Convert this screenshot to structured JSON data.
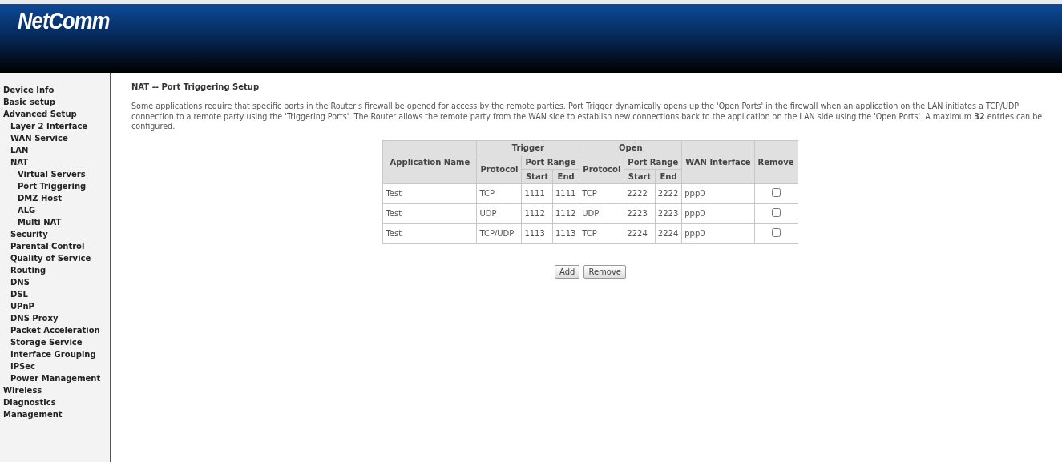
{
  "header": {
    "logo": "NetComm"
  },
  "sidebar": {
    "items": [
      {
        "label": "Device Info"
      },
      {
        "label": "Basic setup"
      },
      {
        "label": "Advanced Setup",
        "children": [
          {
            "label": "Layer 2 Interface"
          },
          {
            "label": "WAN Service"
          },
          {
            "label": "LAN"
          },
          {
            "label": "NAT",
            "children": [
              {
                "label": "Virtual Servers"
              },
              {
                "label": "Port Triggering"
              },
              {
                "label": "DMZ Host"
              },
              {
                "label": "ALG"
              },
              {
                "label": "Multi NAT"
              }
            ]
          },
          {
            "label": "Security"
          },
          {
            "label": "Parental Control"
          },
          {
            "label": "Quality of Service"
          },
          {
            "label": "Routing"
          },
          {
            "label": "DNS"
          },
          {
            "label": "DSL"
          },
          {
            "label": "UPnP"
          },
          {
            "label": "DNS Proxy"
          },
          {
            "label": "Packet Acceleration"
          },
          {
            "label": "Storage Service"
          },
          {
            "label": "Interface Grouping"
          },
          {
            "label": "IPSec"
          },
          {
            "label": "Power Management"
          }
        ]
      },
      {
        "label": "Wireless"
      },
      {
        "label": "Diagnostics"
      },
      {
        "label": "Management"
      }
    ]
  },
  "page": {
    "title": "NAT -- Port Triggering Setup",
    "description": "Some applications require that specific ports in the Router's firewall be opened for access by the remote parties. Port Trigger dynamically opens up the 'Open Ports' in the firewall when an application on the LAN initiates a TCP/UDP connection to a remote party using the 'Triggering Ports'. The Router allows the remote party from the WAN side to establish new connections back to the application on the LAN side using the 'Open Ports'. A maximum **32** entries can be configured."
  },
  "table": {
    "headers": {
      "app": "Application Name",
      "trigger": "Trigger",
      "open": "Open",
      "protocol_1": "Protocol",
      "port_range_1": "Port Range",
      "start_1": "Start",
      "end_1": "End",
      "protocol_2": "Protocol",
      "port_range_2": "Port Range",
      "start_2": "Start",
      "end_2": "End",
      "wan": "WAN Interface",
      "remove": "Remove"
    },
    "rows": [
      {
        "cells": [
          "Test",
          "TCP",
          "1111",
          "1111",
          "TCP",
          "2222",
          "2222",
          "ppp0"
        ],
        "checked": false
      },
      {
        "cells": [
          "Test",
          "UDP",
          "1112",
          "1112",
          "UDP",
          "2223",
          "2223",
          "ppp0"
        ],
        "checked": false
      },
      {
        "cells": [
          "Test",
          "TCP/UDP",
          "1113",
          "1113",
          "TCP",
          "2224",
          "2224",
          "ppp0"
        ],
        "checked": false
      }
    ]
  },
  "buttons": [
    "Add",
    "Remove"
  ]
}
